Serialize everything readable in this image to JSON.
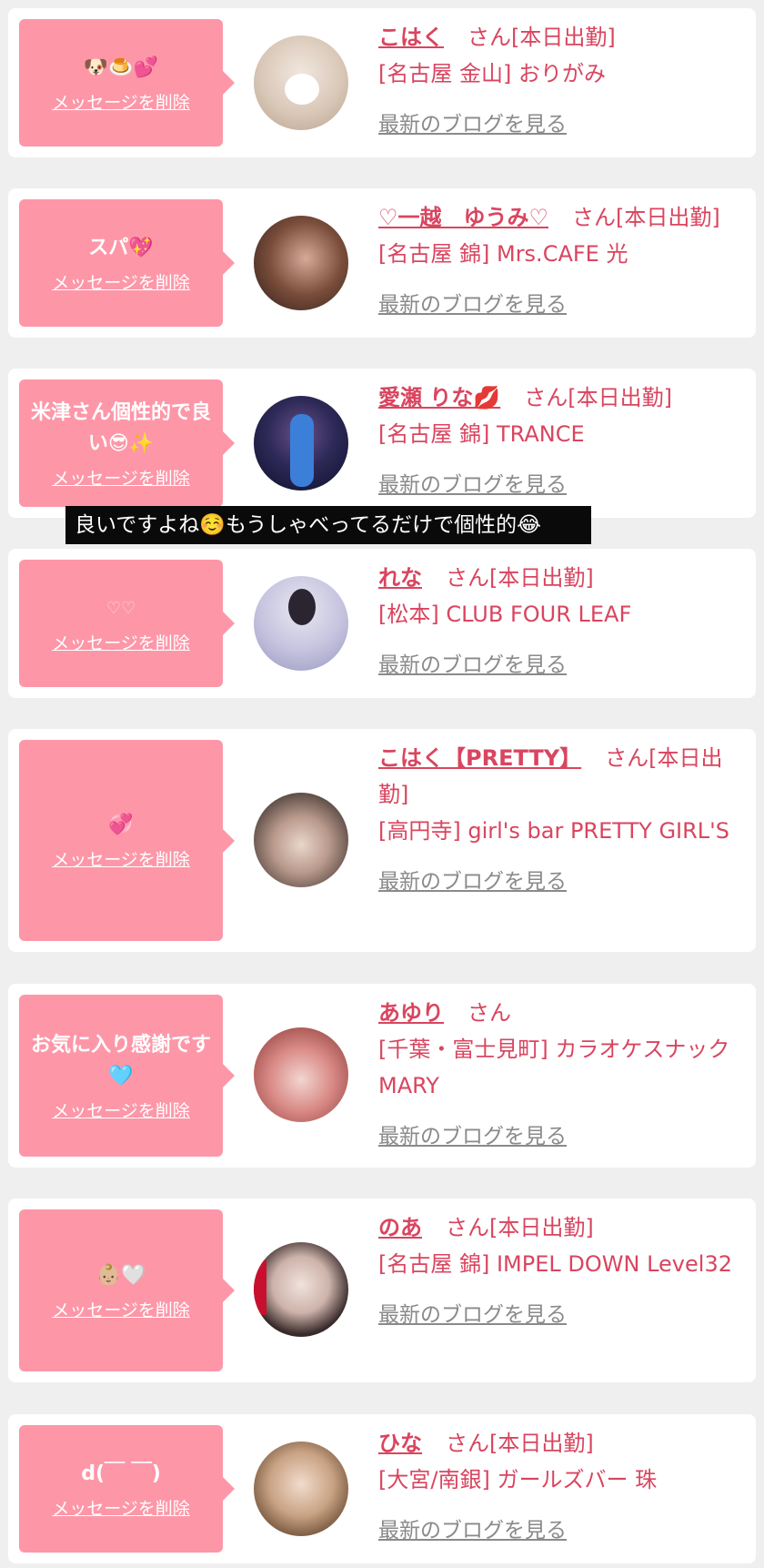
{
  "colors": {
    "pink": "#fd97a8",
    "accent": "#d9455f",
    "link": "#8a8a8a"
  },
  "delete_label": "メッセージを削除",
  "blog_label": "最新のブログを見る",
  "caption": "良いですよね☺️もうしゃべってるだけで個性的😂",
  "cards": [
    {
      "message": "🐶🍮💕",
      "name": "こはく",
      "suffix": "さん[本日出勤]",
      "shop": "[名古屋 金山] おりがみ"
    },
    {
      "message": "スパ💖",
      "name": "♡一越　ゆうみ♡",
      "suffix": "さん[本日出勤]",
      "shop": "[名古屋 錦] Mrs.CAFE 光"
    },
    {
      "message": "米津さん個性的で良い😎✨",
      "name": "愛瀬 りな💋",
      "suffix": "さん[本日出勤]",
      "shop": "[名古屋 錦] TRANCE"
    },
    {
      "message": "♡♡",
      "name": "れな",
      "suffix": "さん[本日出勤]",
      "shop": "[松本] CLUB FOUR LEAF"
    },
    {
      "message": "💞",
      "name": "こはく【PRETTY】",
      "suffix": "さん[本日出勤]",
      "shop": "[高円寺] girl's bar PRETTY GIRL'S"
    },
    {
      "message": "お気に入り感謝です🩵",
      "name": "あゆり",
      "suffix": "さん",
      "shop": "[千葉・富士見町] カラオケスナック MARY"
    },
    {
      "message": "👶🏼🤍",
      "name": "のあ",
      "suffix": "さん[本日出勤]",
      "shop": "[名古屋 錦] IMPEL DOWN Level32"
    },
    {
      "message": "d(￣ ￣)",
      "name": "ひな",
      "suffix": "さん[本日出勤]",
      "shop": "[大宮/南銀] ガールズバー 珠"
    }
  ]
}
